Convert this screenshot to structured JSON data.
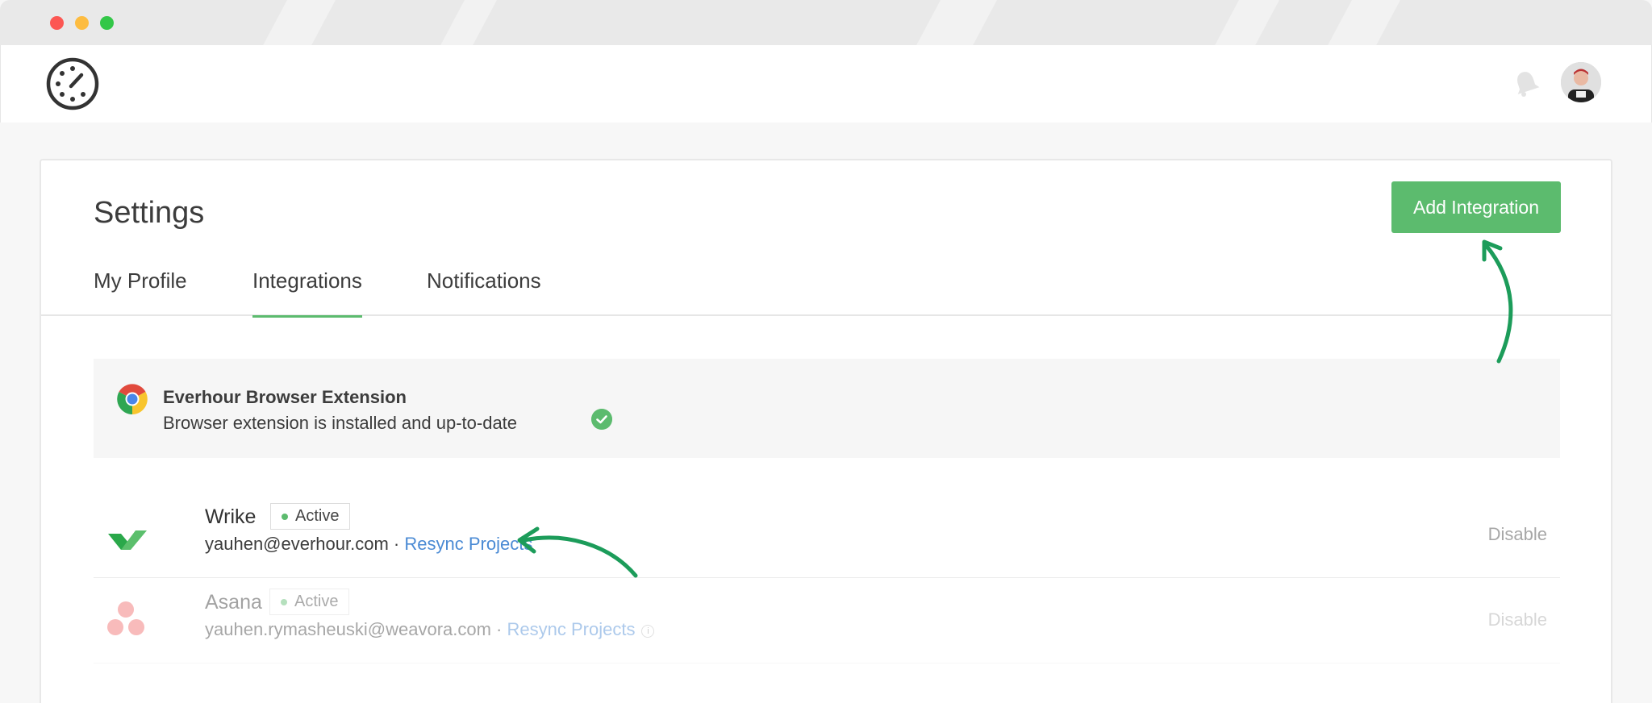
{
  "window": {
    "traffic_lights": [
      "close",
      "minimize",
      "zoom"
    ]
  },
  "header": {
    "logo_icon": "everhour-stopwatch-icon",
    "notification_icon": "bell-icon",
    "avatar": "user-avatar"
  },
  "settings": {
    "title": "Settings",
    "add_button": "Add Integration",
    "tabs": [
      {
        "label": "My Profile",
        "active": false
      },
      {
        "label": "Integrations",
        "active": true
      },
      {
        "label": "Notifications",
        "active": false
      }
    ]
  },
  "extension": {
    "icon": "chrome-icon",
    "title": "Everhour Browser Extension",
    "description": "Browser extension is installed and up-to-date",
    "status_icon": "check-circle-icon"
  },
  "integrations": [
    {
      "name": "Wrike",
      "icon": "wrike-logo-icon",
      "status": "Active",
      "account": "yauhen@everhour.com",
      "separator": " · ",
      "action": "Resync Projects",
      "disable_label": "Disable"
    },
    {
      "name": "Asana",
      "icon": "asana-logo-icon",
      "status": "Active",
      "account": "yauhen.rymasheuski@weavora.com",
      "separator": " · ",
      "action": "Resync Projects",
      "disable_label": "Disable"
    }
  ],
  "colors": {
    "accent_green": "#5cbb6e",
    "link_blue": "#4a8ad4",
    "annotation_arrow": "#1c9c5a"
  }
}
